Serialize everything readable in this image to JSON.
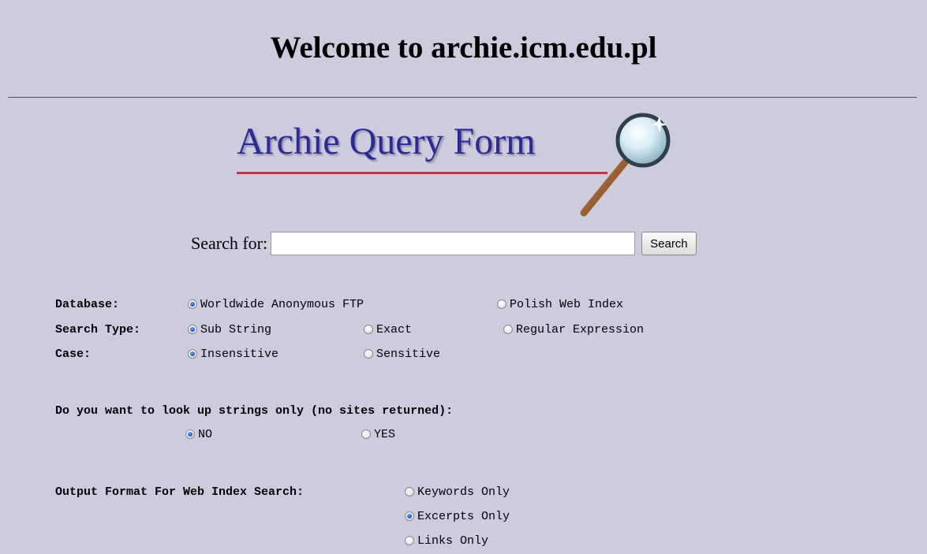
{
  "page": {
    "title": "Welcome to archie.icm.edu.pl"
  },
  "logo": {
    "text": "Archie Query Form",
    "icon": "magnifier-icon"
  },
  "search": {
    "label": "Search for:",
    "value": "",
    "placeholder": "",
    "button_label": "Search"
  },
  "database": {
    "label": "Database:",
    "options": [
      {
        "label": "Worldwide Anonymous FTP",
        "checked": true
      },
      {
        "label": "Polish Web Index",
        "checked": false
      }
    ]
  },
  "search_type": {
    "label": "Search Type:",
    "options": [
      {
        "label": "Sub String",
        "checked": true
      },
      {
        "label": "Exact",
        "checked": false
      },
      {
        "label": "Regular Expression",
        "checked": false
      }
    ]
  },
  "case": {
    "label": "Case:",
    "options": [
      {
        "label": "Insensitive",
        "checked": true
      },
      {
        "label": "Sensitive",
        "checked": false
      }
    ]
  },
  "strings_only": {
    "question": "Do you want to look up strings only (no sites returned):",
    "options": [
      {
        "label": "NO",
        "checked": true
      },
      {
        "label": "YES",
        "checked": false
      }
    ]
  },
  "output_format": {
    "label": "Output Format For Web Index Search:",
    "options": [
      {
        "label": "Keywords Only",
        "checked": false
      },
      {
        "label": "Excerpts Only",
        "checked": true
      },
      {
        "label": "Links Only",
        "checked": false
      }
    ]
  },
  "colors": {
    "background": "#ccccdd",
    "logo_text": "#2a2a9c",
    "logo_underline": "#cc3344",
    "radio_checked": "#1c4fd1"
  }
}
